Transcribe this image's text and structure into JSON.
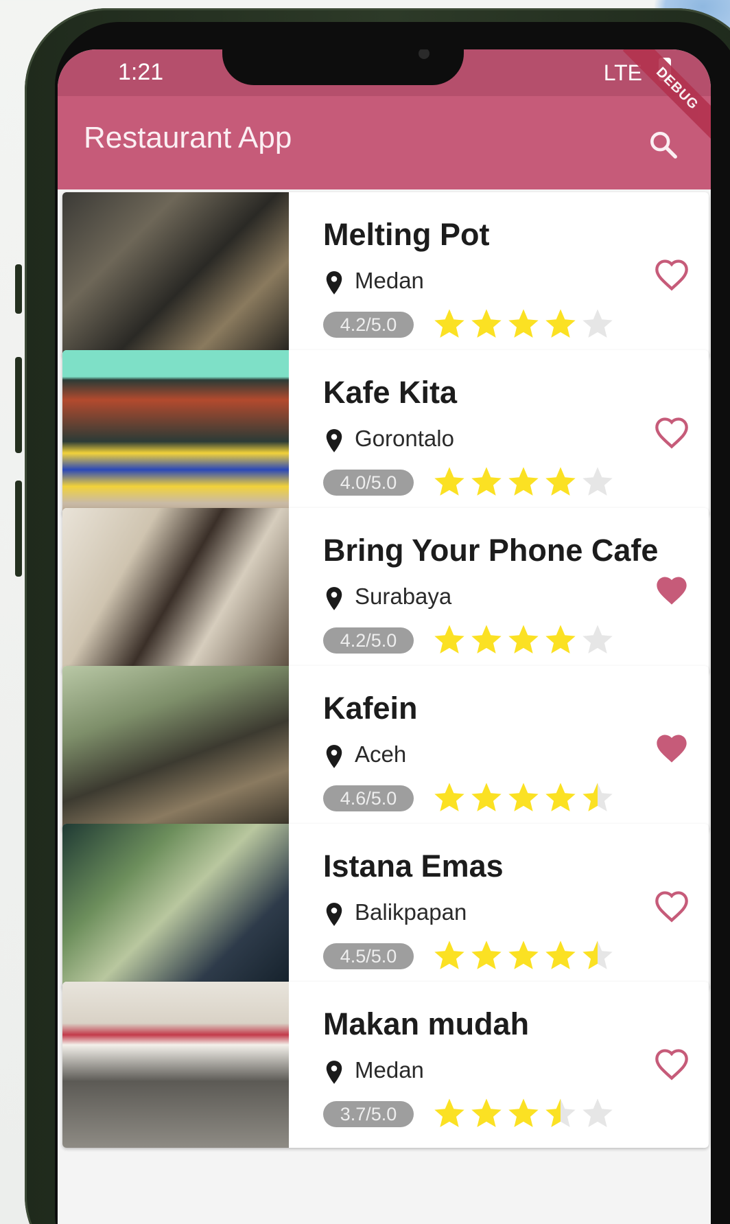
{
  "status_bar": {
    "time": "1:21",
    "network": "LTE"
  },
  "app_bar": {
    "title": "Restaurant App",
    "debug_banner": "DEBUG"
  },
  "colors": {
    "app_bar": "#c65b79",
    "status_bar": "#b54f6c",
    "heart": "#c65b79",
    "star": "#fbe123",
    "star_empty": "#e6e6e6",
    "badge": "#9e9e9e"
  },
  "restaurants": [
    {
      "name": "Melting Pot",
      "city": "Medan",
      "rating_label": "4.2/5.0",
      "rating": 4.2,
      "favorite": false,
      "thumb": "kitchen"
    },
    {
      "name": "Kafe Kita",
      "city": "Gorontalo",
      "rating_label": "4.0/5.0",
      "rating": 4.0,
      "favorite": false,
      "thumb": "storefront"
    },
    {
      "name": "Bring Your Phone Cafe",
      "city": "Surabaya",
      "rating_label": "4.2/5.0",
      "rating": 4.2,
      "favorite": true,
      "thumb": "cafe-interior"
    },
    {
      "name": "Kafein",
      "city": "Aceh",
      "rating_label": "4.6/5.0",
      "rating": 4.6,
      "favorite": true,
      "thumb": "greenhouse"
    },
    {
      "name": "Istana Emas",
      "city": "Balikpapan",
      "rating_label": "4.5/5.0",
      "rating": 4.5,
      "favorite": false,
      "thumb": "patio"
    },
    {
      "name": "Makan mudah",
      "city": "Medan",
      "rating_label": "3.7/5.0",
      "rating": 3.7,
      "favorite": false,
      "thumb": "awning-shop"
    }
  ]
}
